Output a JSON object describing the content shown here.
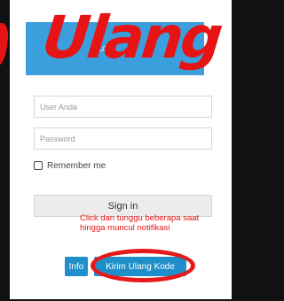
{
  "header": {
    "text": "Lo..."
  },
  "overlay": {
    "word": "Ulang"
  },
  "form": {
    "username_placeholder": "User Anda",
    "password_placeholder": "Password",
    "remember_label": "Remember me",
    "signin_label": "Sign in"
  },
  "note": {
    "line1": "Click dan tunggu beberapa saat",
    "line2": "hingga muncul notifikasi"
  },
  "buttons": {
    "info_label": "Info",
    "resend_label": "Kirim Ulang Kode"
  },
  "colors": {
    "accent_red": "#e61414",
    "header_blue": "#3a9fdc",
    "button_blue": "#1f8fca"
  }
}
